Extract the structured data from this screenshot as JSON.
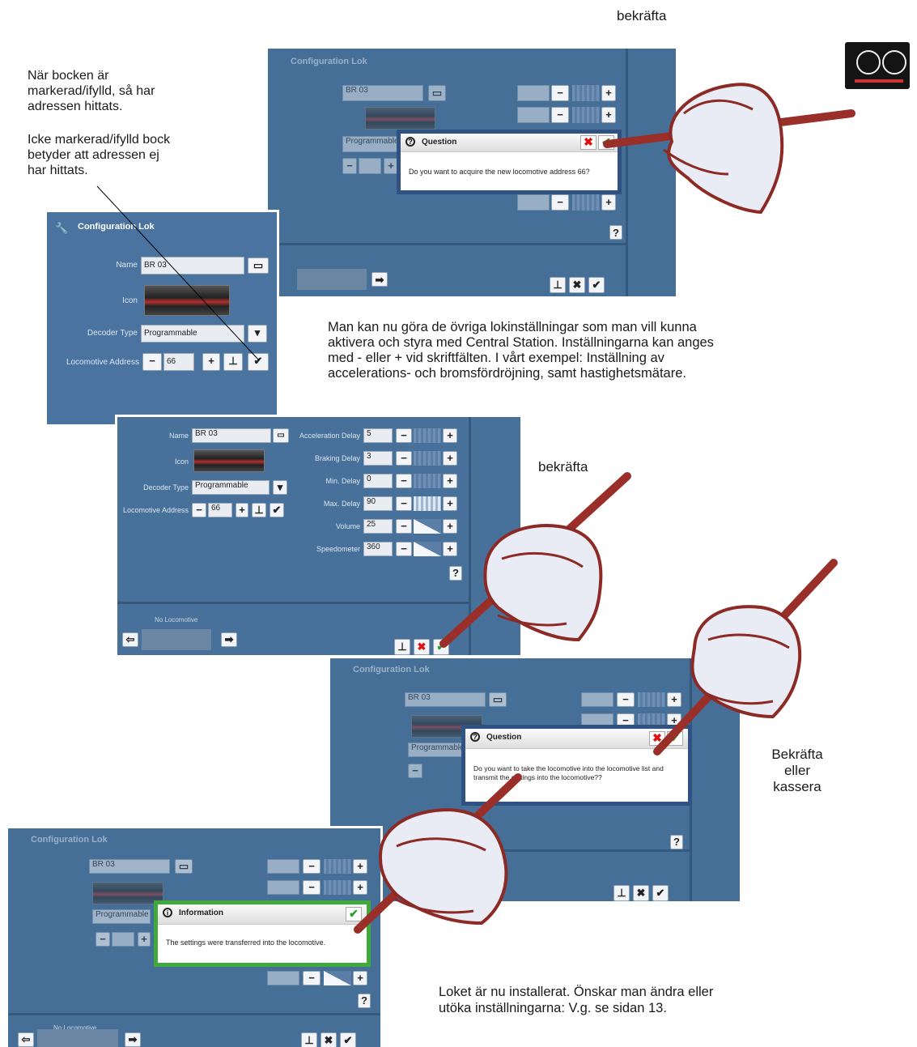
{
  "notes": {
    "bekrafta_top": "bekräfta",
    "bekrafta_mid": "bekräfta",
    "bekrafta_kassera": [
      "Bekräfta",
      "eller",
      "kassera"
    ],
    "checkmark_found": [
      "När bocken är",
      "markerad/ifylld, så har",
      "adressen hittats."
    ],
    "checkmark_not_found": [
      "Icke markerad/ifylld bock",
      "betyder att adressen ej",
      "har hittats."
    ],
    "settings_text": [
      "Man kan nu göra de övriga lokinställningar som man vill kunna",
      "aktivera och styra med Central Station. Inställningarna kan anges",
      "med - eller + vid skriftfälten. I vårt exempel: Inställning av",
      "accelerations- och bromsfördröjning, samt hastighetsmätare."
    ],
    "installed_text": [
      "Loket är nu installerat. Önskar man ändra eller",
      "utöka inställningarna: V.g. se sidan 13."
    ]
  },
  "config_panel": {
    "title": "Configuration Lok",
    "name_label": "Name",
    "name_value": "BR 03",
    "icon_label": "Icon",
    "decoder_label": "Decoder Type",
    "decoder_value": "Programmable",
    "address_label": "Locomotive Address",
    "address_value": "66",
    "minus": "−",
    "plus": "+",
    "dropdown": "▾",
    "check": "✔",
    "help": "?",
    "no_locomotive": "No Locomotive",
    "arrow_right": "➡",
    "arrow_left": "⇦",
    "cancel": "✖"
  },
  "settings_panel": {
    "accel_label": "Acceleration Delay",
    "accel_value": "5",
    "brake_label": "Braking Delay",
    "brake_value": "3",
    "min_label": "Min. Delay",
    "min_value": "0",
    "max_label": "Max. Delay",
    "max_value": "90",
    "volume_label": "Volume",
    "volume_value": "25",
    "speedo_label": "Speedometer",
    "speedo_value": "360"
  },
  "dialog_question1": {
    "icon": "?",
    "title": "Question",
    "body": "Do you want to acquire the new locomotive address 66?"
  },
  "dialog_question2": {
    "icon": "?",
    "title": "Question",
    "body": "Do you want to take the locomotive into the locomotive list and transmit the settings into the locomotive??"
  },
  "dialog_info": {
    "icon": "i",
    "title": "Information",
    "body": "The settings were transferred into the locomotive."
  },
  "colors": {
    "panel": "#47709a",
    "dialog_border": "#2f5282",
    "info_border": "#3fa93b",
    "pen": "#9a2f2a"
  }
}
